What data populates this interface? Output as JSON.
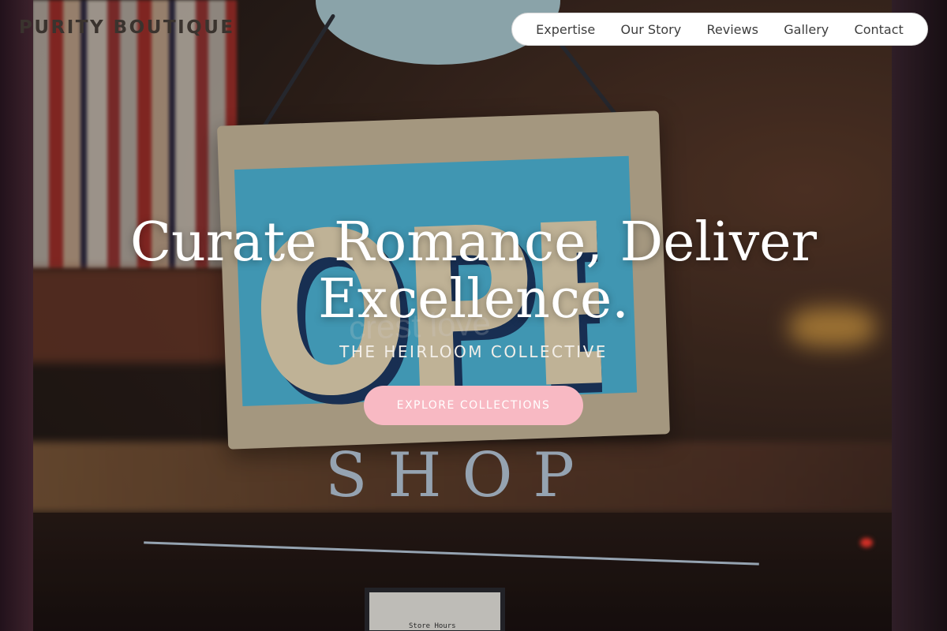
{
  "brand": {
    "name": "PURITY BOUTIQUE"
  },
  "nav": {
    "items": [
      {
        "label": "Expertise"
      },
      {
        "label": "Our Story"
      },
      {
        "label": "Reviews"
      },
      {
        "label": "Gallery"
      },
      {
        "label": "Contact"
      }
    ]
  },
  "hero": {
    "headline": "Curate Romance, Deliver Excellence.",
    "subtitle": "THE HEIRLOOM COLLECTIVE",
    "cta_label": "EXPLORE COLLECTIONS",
    "photo": {
      "sign_text": "OPEN",
      "sign_faint_text": "crest love",
      "window_text": "SHOP",
      "card_text": "Store Hours"
    }
  },
  "colors": {
    "cta": "#f8b9c3",
    "headline": "#ffffff",
    "brand": "#3a332e",
    "nav_bg": "#ffffff"
  }
}
